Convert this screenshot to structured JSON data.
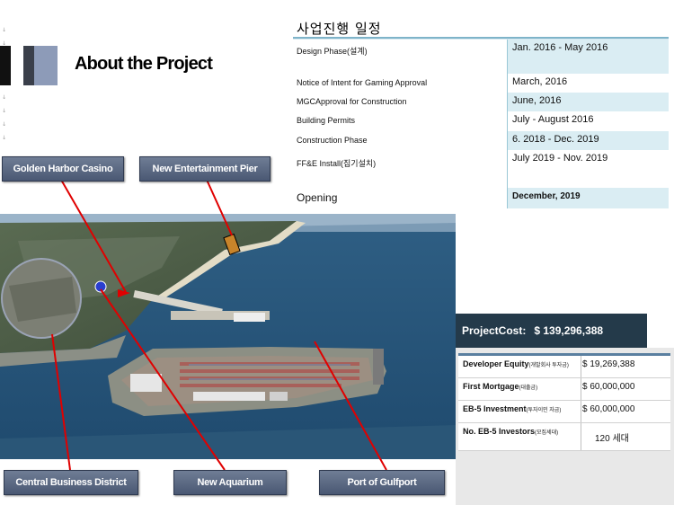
{
  "header": {
    "title": "About the Project"
  },
  "schedule": {
    "title": "사업진행 일정",
    "rows": [
      {
        "label": "Design Phase(설계)",
        "value": "Jan. 2016 - May 2016"
      },
      {
        "label": "Notice of Intent for Gaming Approval",
        "value": "March, 2016"
      },
      {
        "label": "MGCApproval for Construction",
        "value": "June, 2016"
      },
      {
        "label": "Building Permits",
        "value": "July - August 2016"
      },
      {
        "label": "Construction Phase",
        "value": "6. 2018 - Dec. 2019"
      },
      {
        "label": "FF&E Install(집기설치)",
        "value": "July 2019 - Nov. 2019"
      },
      {
        "label": "Opening",
        "value": "December, 2019"
      }
    ]
  },
  "callouts": {
    "casino": "Golden Harbor Casino",
    "pier": "New Entertainment  Pier",
    "cbd": "Central Business District",
    "aquarium": "New Aquarium",
    "port": "Port of Gulfport"
  },
  "cost": {
    "label": "ProjectCost:",
    "value": "$ 139,296,388"
  },
  "financing": {
    "rows": [
      {
        "label": "Developer Equity",
        "note": "(개발회사 투자금)",
        "value": "$ 19,269,388"
      },
      {
        "label": "First Mortgage",
        "note": "(대출금)",
        "value": "$  60,000,000"
      },
      {
        "label": "EB-5 Investment",
        "note": "(투자이민 자금)",
        "value": "$ 60,000,000"
      },
      {
        "label": "No. EB-5 Investors",
        "note": "(모집세대)",
        "value": "120 세대"
      }
    ]
  },
  "colors": {
    "accent": "#7fb4c9",
    "cost_bg": "#243a4a",
    "callout_bg": "#5a6882",
    "leader": "#e00000"
  }
}
